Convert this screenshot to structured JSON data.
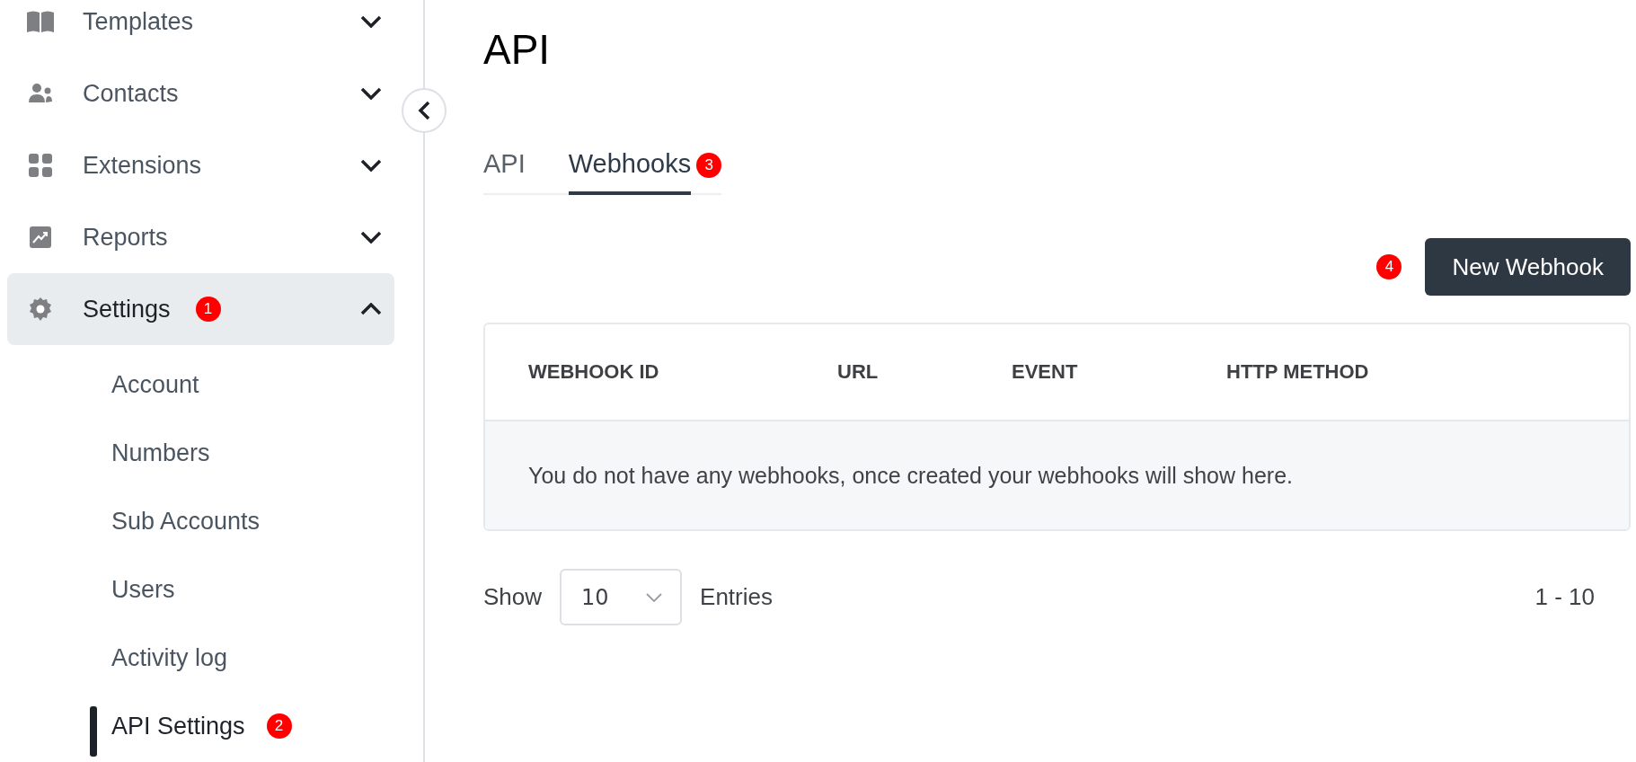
{
  "sidebar": {
    "items": [
      {
        "label": "Templates",
        "expanded": false,
        "selected": false
      },
      {
        "label": "Contacts",
        "expanded": false,
        "selected": false
      },
      {
        "label": "Extensions",
        "expanded": false,
        "selected": false
      },
      {
        "label": "Reports",
        "expanded": false,
        "selected": false
      },
      {
        "label": "Settings",
        "expanded": true,
        "selected": true,
        "badge": "1",
        "children": [
          {
            "label": "Account",
            "selected": false
          },
          {
            "label": "Numbers",
            "selected": false
          },
          {
            "label": "Sub Accounts",
            "selected": false
          },
          {
            "label": "Users",
            "selected": false
          },
          {
            "label": "Activity log",
            "selected": false
          },
          {
            "label": "API Settings",
            "selected": true,
            "badge": "2"
          }
        ]
      }
    ]
  },
  "page": {
    "title": "API"
  },
  "tabs": [
    {
      "label": "API",
      "selected": false
    },
    {
      "label": "Webhooks",
      "selected": true,
      "badge": "3"
    }
  ],
  "new_button": {
    "label": "New Webhook",
    "badge": "4"
  },
  "table": {
    "columns": [
      "WEBHOOK ID",
      "URL",
      "EVENT",
      "HTTP METHOD"
    ],
    "empty_message": "You do not have any webhooks, once created your webhooks will show here."
  },
  "pagination": {
    "show_label": "Show",
    "page_size": "10",
    "entries_label": "Entries",
    "range": "1 - 10"
  }
}
